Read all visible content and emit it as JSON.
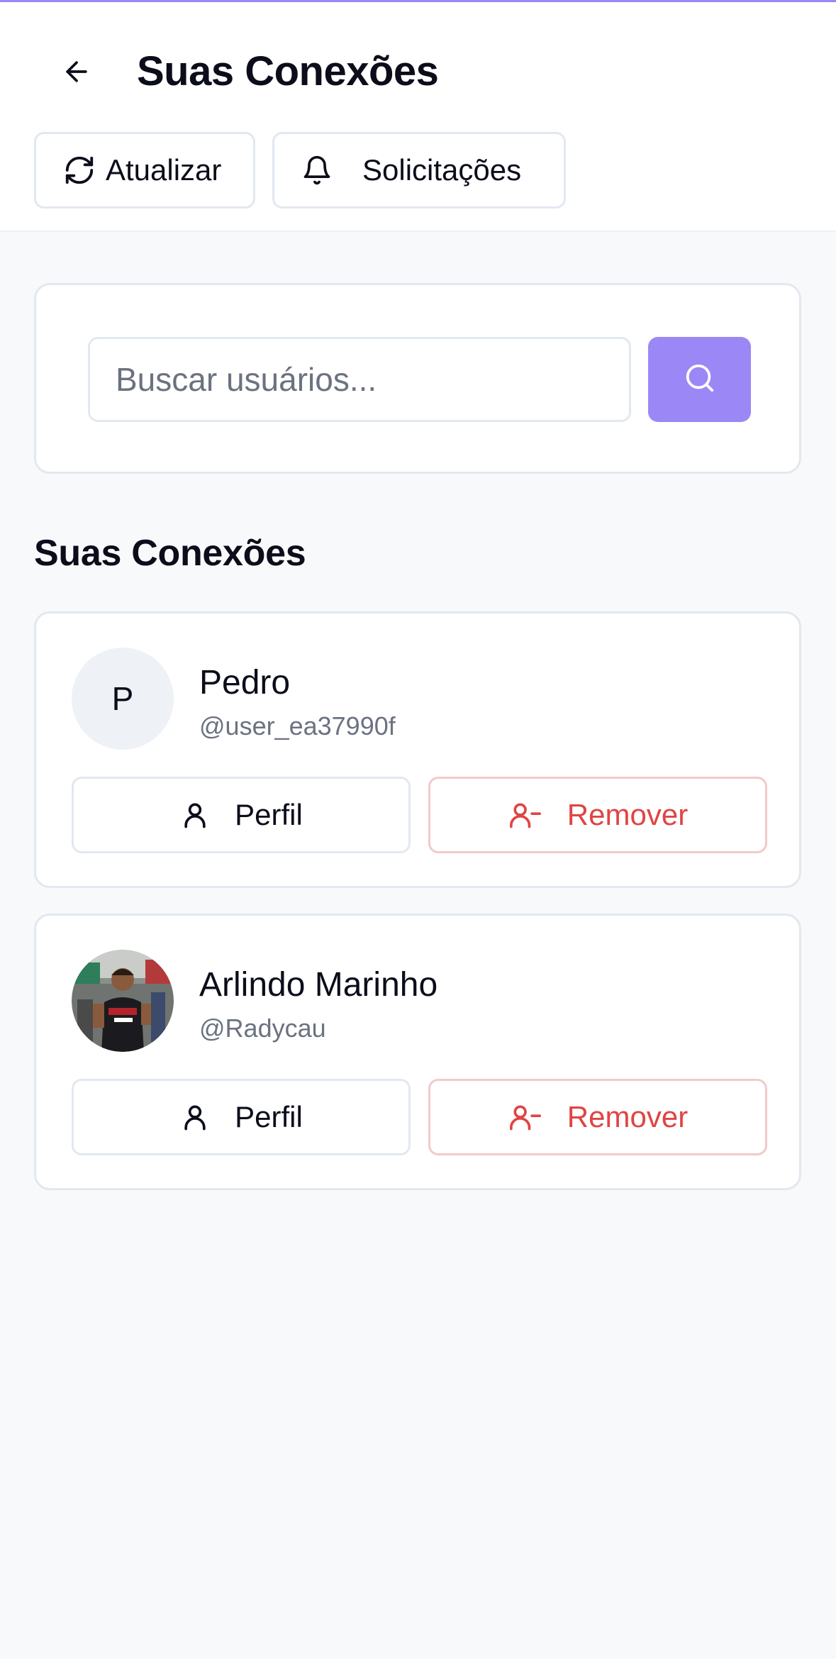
{
  "header": {
    "title": "Suas Conexões",
    "refresh_label": "Atualizar",
    "requests_label": "Solicitações"
  },
  "search": {
    "placeholder": "Buscar usuários..."
  },
  "section_title": "Suas Conexões",
  "connections": [
    {
      "initial": "P",
      "name": "Pedro",
      "handle": "@user_ea37990f",
      "profile_label": "Perfil",
      "remove_label": "Remover"
    },
    {
      "initial": "",
      "name": "Arlindo Marinho",
      "handle": "@Radycau",
      "profile_label": "Perfil",
      "remove_label": "Remover"
    }
  ],
  "colors": {
    "accent": "#9b87f5",
    "danger": "#e04444",
    "border": "#e2e8f0",
    "background": "#f8f9fb"
  },
  "icons": {
    "back": "arrow-left-icon",
    "refresh": "refresh-icon",
    "requests": "bell-icon",
    "search": "search-icon",
    "profile": "user-icon",
    "remove": "user-minus-icon"
  }
}
